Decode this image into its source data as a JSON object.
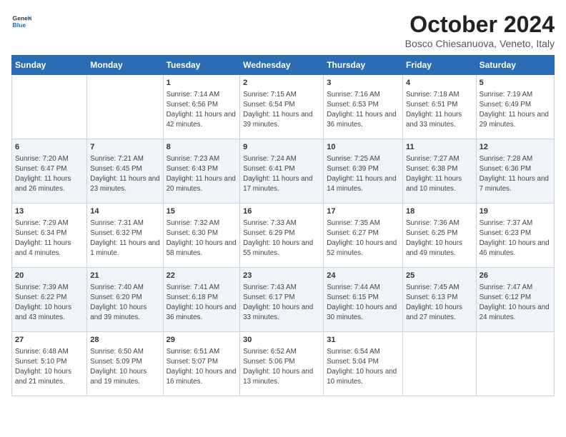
{
  "header": {
    "logo_line1": "General",
    "logo_line2": "Blue",
    "month": "October 2024",
    "location": "Bosco Chiesanuova, Veneto, Italy"
  },
  "weekdays": [
    "Sunday",
    "Monday",
    "Tuesday",
    "Wednesday",
    "Thursday",
    "Friday",
    "Saturday"
  ],
  "rows": [
    [
      {
        "day": "",
        "sunrise": "",
        "sunset": "",
        "daylight": ""
      },
      {
        "day": "",
        "sunrise": "",
        "sunset": "",
        "daylight": ""
      },
      {
        "day": "1",
        "sunrise": "Sunrise: 7:14 AM",
        "sunset": "Sunset: 6:56 PM",
        "daylight": "Daylight: 11 hours and 42 minutes."
      },
      {
        "day": "2",
        "sunrise": "Sunrise: 7:15 AM",
        "sunset": "Sunset: 6:54 PM",
        "daylight": "Daylight: 11 hours and 39 minutes."
      },
      {
        "day": "3",
        "sunrise": "Sunrise: 7:16 AM",
        "sunset": "Sunset: 6:53 PM",
        "daylight": "Daylight: 11 hours and 36 minutes."
      },
      {
        "day": "4",
        "sunrise": "Sunrise: 7:18 AM",
        "sunset": "Sunset: 6:51 PM",
        "daylight": "Daylight: 11 hours and 33 minutes."
      },
      {
        "day": "5",
        "sunrise": "Sunrise: 7:19 AM",
        "sunset": "Sunset: 6:49 PM",
        "daylight": "Daylight: 11 hours and 29 minutes."
      }
    ],
    [
      {
        "day": "6",
        "sunrise": "Sunrise: 7:20 AM",
        "sunset": "Sunset: 6:47 PM",
        "daylight": "Daylight: 11 hours and 26 minutes."
      },
      {
        "day": "7",
        "sunrise": "Sunrise: 7:21 AM",
        "sunset": "Sunset: 6:45 PM",
        "daylight": "Daylight: 11 hours and 23 minutes."
      },
      {
        "day": "8",
        "sunrise": "Sunrise: 7:23 AM",
        "sunset": "Sunset: 6:43 PM",
        "daylight": "Daylight: 11 hours and 20 minutes."
      },
      {
        "day": "9",
        "sunrise": "Sunrise: 7:24 AM",
        "sunset": "Sunset: 6:41 PM",
        "daylight": "Daylight: 11 hours and 17 minutes."
      },
      {
        "day": "10",
        "sunrise": "Sunrise: 7:25 AM",
        "sunset": "Sunset: 6:39 PM",
        "daylight": "Daylight: 11 hours and 14 minutes."
      },
      {
        "day": "11",
        "sunrise": "Sunrise: 7:27 AM",
        "sunset": "Sunset: 6:38 PM",
        "daylight": "Daylight: 11 hours and 10 minutes."
      },
      {
        "day": "12",
        "sunrise": "Sunrise: 7:28 AM",
        "sunset": "Sunset: 6:36 PM",
        "daylight": "Daylight: 11 hours and 7 minutes."
      }
    ],
    [
      {
        "day": "13",
        "sunrise": "Sunrise: 7:29 AM",
        "sunset": "Sunset: 6:34 PM",
        "daylight": "Daylight: 11 hours and 4 minutes."
      },
      {
        "day": "14",
        "sunrise": "Sunrise: 7:31 AM",
        "sunset": "Sunset: 6:32 PM",
        "daylight": "Daylight: 11 hours and 1 minute."
      },
      {
        "day": "15",
        "sunrise": "Sunrise: 7:32 AM",
        "sunset": "Sunset: 6:30 PM",
        "daylight": "Daylight: 10 hours and 58 minutes."
      },
      {
        "day": "16",
        "sunrise": "Sunrise: 7:33 AM",
        "sunset": "Sunset: 6:29 PM",
        "daylight": "Daylight: 10 hours and 55 minutes."
      },
      {
        "day": "17",
        "sunrise": "Sunrise: 7:35 AM",
        "sunset": "Sunset: 6:27 PM",
        "daylight": "Daylight: 10 hours and 52 minutes."
      },
      {
        "day": "18",
        "sunrise": "Sunrise: 7:36 AM",
        "sunset": "Sunset: 6:25 PM",
        "daylight": "Daylight: 10 hours and 49 minutes."
      },
      {
        "day": "19",
        "sunrise": "Sunrise: 7:37 AM",
        "sunset": "Sunset: 6:23 PM",
        "daylight": "Daylight: 10 hours and 46 minutes."
      }
    ],
    [
      {
        "day": "20",
        "sunrise": "Sunrise: 7:39 AM",
        "sunset": "Sunset: 6:22 PM",
        "daylight": "Daylight: 10 hours and 43 minutes."
      },
      {
        "day": "21",
        "sunrise": "Sunrise: 7:40 AM",
        "sunset": "Sunset: 6:20 PM",
        "daylight": "Daylight: 10 hours and 39 minutes."
      },
      {
        "day": "22",
        "sunrise": "Sunrise: 7:41 AM",
        "sunset": "Sunset: 6:18 PM",
        "daylight": "Daylight: 10 hours and 36 minutes."
      },
      {
        "day": "23",
        "sunrise": "Sunrise: 7:43 AM",
        "sunset": "Sunset: 6:17 PM",
        "daylight": "Daylight: 10 hours and 33 minutes."
      },
      {
        "day": "24",
        "sunrise": "Sunrise: 7:44 AM",
        "sunset": "Sunset: 6:15 PM",
        "daylight": "Daylight: 10 hours and 30 minutes."
      },
      {
        "day": "25",
        "sunrise": "Sunrise: 7:45 AM",
        "sunset": "Sunset: 6:13 PM",
        "daylight": "Daylight: 10 hours and 27 minutes."
      },
      {
        "day": "26",
        "sunrise": "Sunrise: 7:47 AM",
        "sunset": "Sunset: 6:12 PM",
        "daylight": "Daylight: 10 hours and 24 minutes."
      }
    ],
    [
      {
        "day": "27",
        "sunrise": "Sunrise: 6:48 AM",
        "sunset": "Sunset: 5:10 PM",
        "daylight": "Daylight: 10 hours and 21 minutes."
      },
      {
        "day": "28",
        "sunrise": "Sunrise: 6:50 AM",
        "sunset": "Sunset: 5:09 PM",
        "daylight": "Daylight: 10 hours and 19 minutes."
      },
      {
        "day": "29",
        "sunrise": "Sunrise: 6:51 AM",
        "sunset": "Sunset: 5:07 PM",
        "daylight": "Daylight: 10 hours and 16 minutes."
      },
      {
        "day": "30",
        "sunrise": "Sunrise: 6:52 AM",
        "sunset": "Sunset: 5:06 PM",
        "daylight": "Daylight: 10 hours and 13 minutes."
      },
      {
        "day": "31",
        "sunrise": "Sunrise: 6:54 AM",
        "sunset": "Sunset: 5:04 PM",
        "daylight": "Daylight: 10 hours and 10 minutes."
      },
      {
        "day": "",
        "sunrise": "",
        "sunset": "",
        "daylight": ""
      },
      {
        "day": "",
        "sunrise": "",
        "sunset": "",
        "daylight": ""
      }
    ]
  ]
}
